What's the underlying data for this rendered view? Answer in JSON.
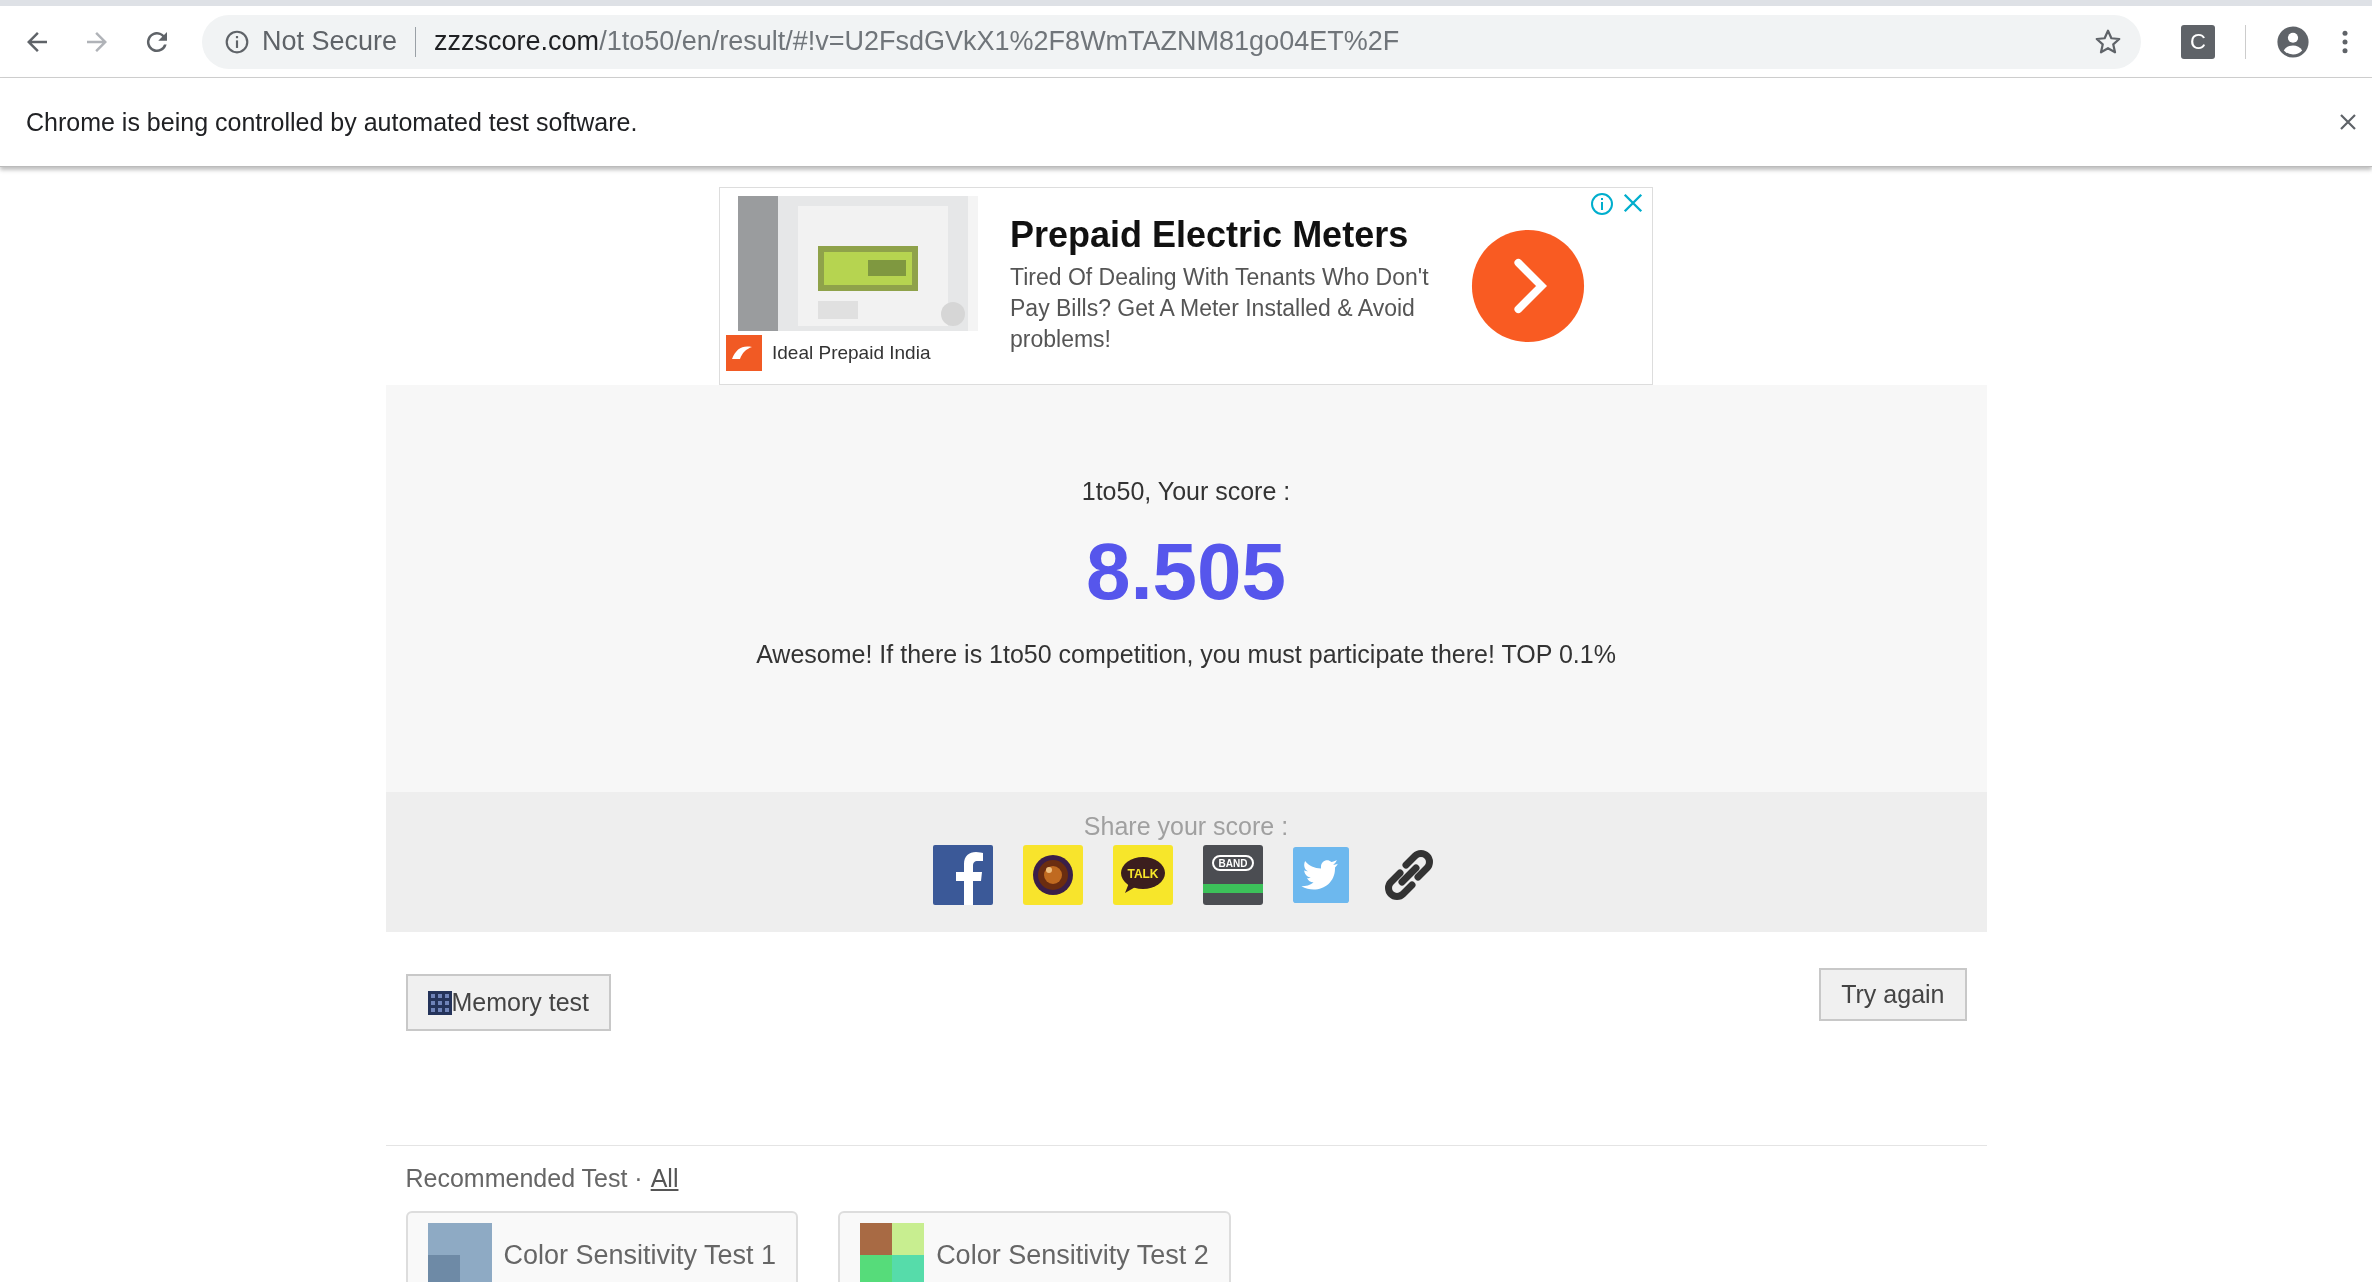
{
  "browser": {
    "security_label": "Not Secure",
    "url_host": "zzzscore.com",
    "url_path": "/1to50/en/result/#!v=U2FsdGVkX1%2F8WmTAZNM81go04ET%2F",
    "extension_label": "C"
  },
  "infobar": {
    "message": "Chrome is being controlled by automated test software."
  },
  "ad": {
    "title": "Prepaid Electric Meters",
    "body": "Tired Of Dealing With Tenants Who Don't Pay Bills? Get A Meter Installed & Avoid problems!",
    "advertiser": "Ideal Prepaid India"
  },
  "result": {
    "label": "1to50, Your score :",
    "score": "8.505",
    "message": "Awesome! If there is 1to50 competition, you must participate there! TOP 0.1%"
  },
  "share": {
    "label": "Share your score :",
    "buttons": [
      {
        "kind": "facebook"
      },
      {
        "kind": "camera"
      },
      {
        "kind": "talk",
        "text": "TALK"
      },
      {
        "kind": "band",
        "text": "BAND"
      },
      {
        "kind": "twitter"
      },
      {
        "kind": "link"
      }
    ]
  },
  "actions": {
    "memory_test": "Memory test",
    "try_again": "Try again"
  },
  "recommended": {
    "heading": "Recommended Test ·",
    "link": "All",
    "items": [
      {
        "title": "Color Sensitivity Test 1"
      },
      {
        "title": "Color Sensitivity Test 2"
      }
    ]
  }
}
